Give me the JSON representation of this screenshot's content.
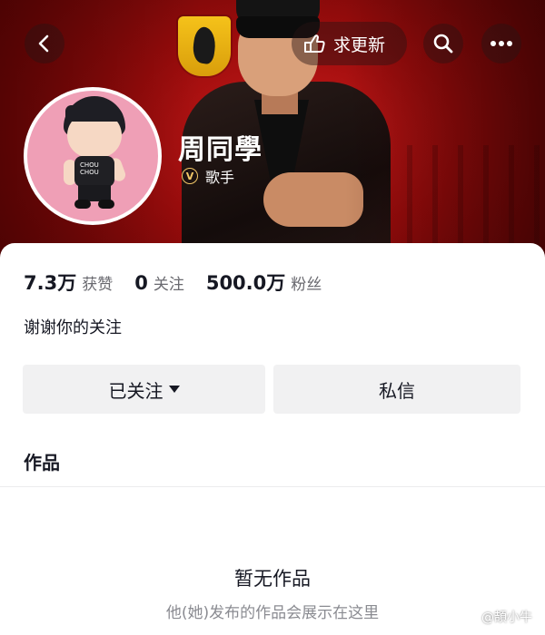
{
  "header": {
    "update_button_label": "求更新",
    "profile_name": "周同學",
    "verified_badge_letter": "V",
    "verified_title": "歌手"
  },
  "stats": [
    {
      "value": "7.3万",
      "label": "获赞"
    },
    {
      "value": "0",
      "label": "关注"
    },
    {
      "value": "500.0万",
      "label": "粉丝"
    }
  ],
  "bio": "谢谢你的关注",
  "actions": {
    "following_label": "已关注",
    "message_label": "私信"
  },
  "works": {
    "section_title": "作品",
    "empty_title": "暂无作品",
    "empty_subtitle": "他(她)发布的作品会展示在这里"
  },
  "watermark": {
    "text": "@頡小牛"
  },
  "colors": {
    "banner_red": "#b01515",
    "avatar_bg": "#ef9fb6",
    "button_bg": "#f1f1f2",
    "badge_gold": "#f3c868",
    "text_primary": "#161823",
    "text_secondary": "#69696f"
  },
  "icons": {
    "back": "chevron-left-icon",
    "update": "hand-pointer-icon",
    "search": "search-icon",
    "more": "more-dots-icon",
    "verified": "verified-v-icon",
    "dropdown": "caret-down-icon"
  }
}
